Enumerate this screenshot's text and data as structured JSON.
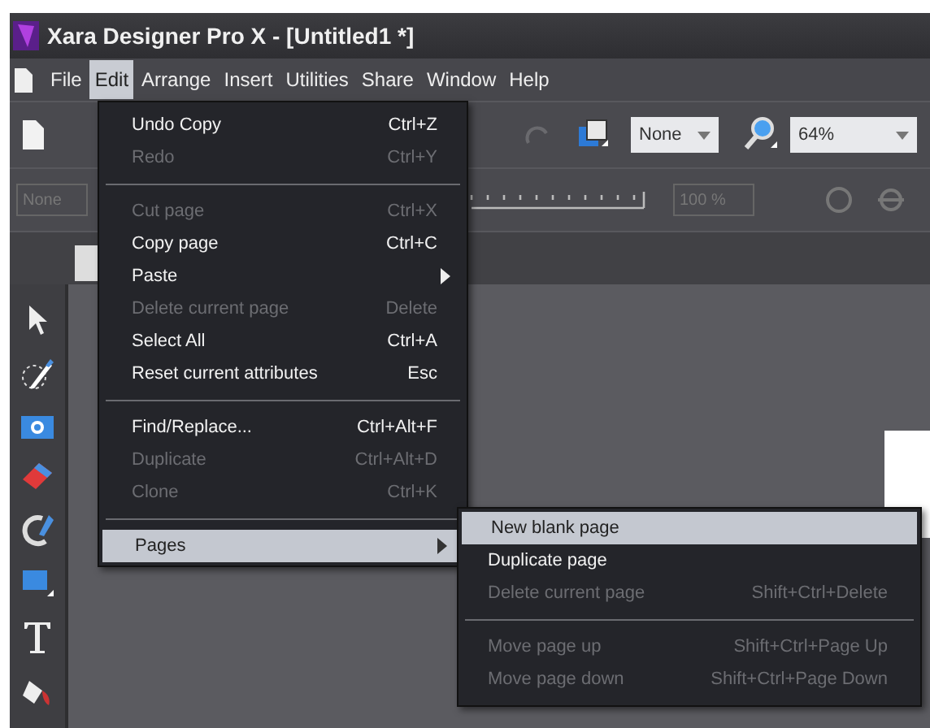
{
  "window": {
    "title": "Xara Designer Pro X - [Untitled1 *]"
  },
  "menubar": [
    {
      "label": "File",
      "selected": false
    },
    {
      "label": "Edit",
      "selected": true
    },
    {
      "label": "Arrange",
      "selected": false
    },
    {
      "label": "Insert",
      "selected": false
    },
    {
      "label": "Utilities",
      "selected": false
    },
    {
      "label": "Share",
      "selected": false
    },
    {
      "label": "Window",
      "selected": false
    },
    {
      "label": "Help",
      "selected": false
    }
  ],
  "toolbar": {
    "quality_dropdown": "None",
    "zoom_dropdown": "64%"
  },
  "toolbar2": {
    "name_field": "None",
    "percent_field": "100 %"
  },
  "edit_menu": [
    {
      "kind": "item",
      "label": "Undo Copy",
      "shortcut": "Ctrl+Z",
      "disabled": false,
      "submenu": false,
      "selected": false
    },
    {
      "kind": "item",
      "label": "Redo",
      "shortcut": "Ctrl+Y",
      "disabled": true,
      "submenu": false,
      "selected": false
    },
    {
      "kind": "separator"
    },
    {
      "kind": "item",
      "label": "Cut page",
      "shortcut": "Ctrl+X",
      "disabled": true,
      "submenu": false,
      "selected": false
    },
    {
      "kind": "item",
      "label": "Copy page",
      "shortcut": "Ctrl+C",
      "disabled": false,
      "submenu": false,
      "selected": false
    },
    {
      "kind": "item",
      "label": "Paste",
      "disabled": false,
      "submenu": true,
      "selected": false
    },
    {
      "kind": "item",
      "label": "Delete current page",
      "shortcut": "Delete",
      "disabled": true,
      "submenu": false,
      "selected": false
    },
    {
      "kind": "item",
      "label": "Select All",
      "shortcut": "Ctrl+A",
      "disabled": false,
      "submenu": false,
      "selected": false
    },
    {
      "kind": "item",
      "label": "Reset current attributes",
      "shortcut": "Esc",
      "disabled": false,
      "submenu": false,
      "selected": false
    },
    {
      "kind": "separator"
    },
    {
      "kind": "item",
      "label": "Find/Replace...",
      "shortcut": "Ctrl+Alt+F",
      "disabled": false,
      "submenu": false,
      "selected": false
    },
    {
      "kind": "item",
      "label": "Duplicate",
      "shortcut": "Ctrl+Alt+D",
      "disabled": true,
      "submenu": false,
      "selected": false
    },
    {
      "kind": "item",
      "label": "Clone",
      "shortcut": "Ctrl+K",
      "disabled": true,
      "submenu": false,
      "selected": false
    },
    {
      "kind": "separator"
    },
    {
      "kind": "item",
      "label": "Pages",
      "disabled": false,
      "submenu": true,
      "selected": true
    }
  ],
  "pages_submenu": [
    {
      "kind": "item",
      "label": "New blank page",
      "disabled": false,
      "selected": true
    },
    {
      "kind": "item",
      "label": "Duplicate page",
      "disabled": false,
      "selected": false
    },
    {
      "kind": "item",
      "label": "Delete current page",
      "shortcut": "Shift+Ctrl+Delete",
      "disabled": true,
      "selected": false
    },
    {
      "kind": "separator"
    },
    {
      "kind": "item",
      "label": "Move page up",
      "shortcut": "Shift+Ctrl+Page Up",
      "disabled": true,
      "selected": false
    },
    {
      "kind": "item",
      "label": "Move page down",
      "shortcut": "Shift+Ctrl+Page Down",
      "disabled": true,
      "selected": false
    }
  ]
}
